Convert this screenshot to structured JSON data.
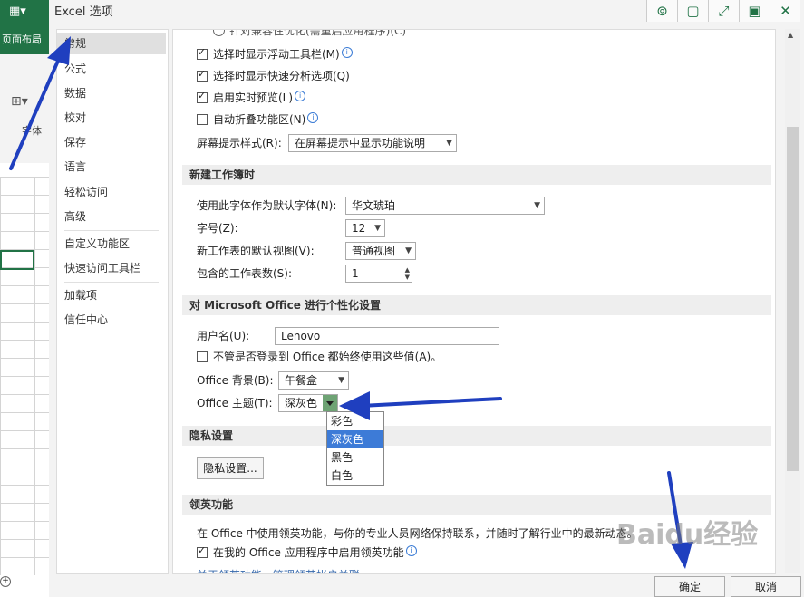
{
  "excel_bg": {
    "ribbon_tab": "页面布局",
    "font_group": "字体"
  },
  "dialog": {
    "title": "Excel 选项"
  },
  "nav": {
    "items": [
      "常规",
      "公式",
      "数据",
      "校对",
      "保存",
      "语言",
      "轻松访问",
      "高级",
      "自定义功能区",
      "快速访问工具栏",
      "加载项",
      "信任中心"
    ],
    "selected": "常规"
  },
  "ui_options": {
    "top_cut": "针对兼容性优化(需重启应用程序)(C)",
    "mini_toolbar": "选择时显示浮动工具栏(M)",
    "quick_analysis": "选择时显示快速分析选项(Q)",
    "live_preview": "启用实时预览(L)",
    "collapse_ribbon": "自动折叠功能区(N)",
    "screentip_label": "屏幕提示样式(R):",
    "screentip_value": "在屏幕提示中显示功能说明"
  },
  "new_workbook": {
    "header": "新建工作簿时",
    "font_label": "使用此字体作为默认字体(N):",
    "font_value": "华文琥珀",
    "size_label": "字号(Z):",
    "size_value": "12",
    "view_label": "新工作表的默认视图(V):",
    "view_value": "普通视图",
    "sheets_label": "包含的工作表数(S):",
    "sheets_value": "1"
  },
  "personalize": {
    "header": "对 Microsoft Office 进行个性化设置",
    "username_label": "用户名(U):",
    "username_value": "Lenovo",
    "always_use": "不管是否登录到 Office 都始终使用这些值(A)。",
    "background_label": "Office 背景(B):",
    "background_value": "午餐盒",
    "theme_label": "Office 主题(T):",
    "theme_value": "深灰色",
    "theme_options": [
      "彩色",
      "深灰色",
      "黑色",
      "白色"
    ],
    "theme_highlighted": "深灰色"
  },
  "privacy": {
    "header": "隐私设置",
    "button": "隐私设置..."
  },
  "linkedin": {
    "header": "领英功能",
    "description": "在 Office 中使用领英功能，与你的专业人员网络保持联系，并随时了解行业中的最新动态。",
    "enable": "在我的 Office 应用程序中启用领英功能",
    "cut_text": "关于领英功能，管理领英帐户关联"
  },
  "footer": {
    "ok": "确定",
    "cancel": "取消"
  },
  "watermark": "Baidu经验",
  "colors": {
    "excel_green": "#217346",
    "highlight": "#3d7bd7",
    "annotation_arrow": "#1f3fbf"
  }
}
